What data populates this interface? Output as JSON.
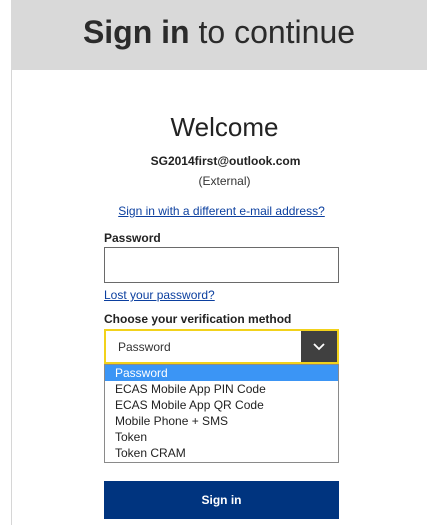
{
  "header": {
    "title_bold": "Sign in",
    "title_rest": "to continue"
  },
  "welcome": "Welcome",
  "account": {
    "email": "SG2014first@outlook.com",
    "type": "(External)"
  },
  "different_email_link": "Sign in with a different e-mail address?",
  "password": {
    "label": "Password",
    "value": "",
    "lost_link": "Lost your password?"
  },
  "verification": {
    "label": "Choose your verification method",
    "selected": "Password",
    "options": [
      "Password",
      "ECAS Mobile App PIN Code",
      "ECAS Mobile App QR Code",
      "Mobile Phone + SMS",
      "Token",
      "Token CRAM"
    ]
  },
  "sign_in_button": "Sign in",
  "colors": {
    "primary": "#00347f",
    "link": "#0b3f9f",
    "focus": "#f2d21b",
    "highlight": "#3b95f5",
    "header_bg": "#d9d9d9"
  },
  "icons": {
    "select": "chevron-down-icon"
  }
}
